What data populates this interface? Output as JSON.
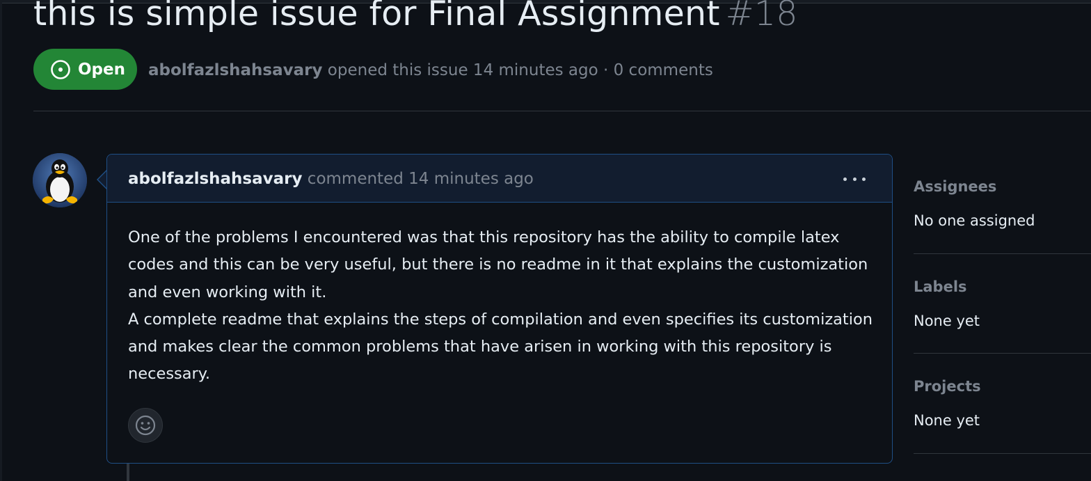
{
  "issue": {
    "title": "this is simple issue for Final Assignment",
    "number": "#18",
    "state": "Open",
    "author": "abolfazlshahsavary",
    "meta_text": " opened this issue 14 minutes ago · 0 comments"
  },
  "comment": {
    "author": "abolfazlshahsavary",
    "header_text": " commented 14 minutes ago",
    "body": [
      "One of the problems I encountered was that this repository has the ability to compile latex codes and this can be very useful, but there is no readme in it that explains the customization and even working with it.",
      "A complete readme that explains the steps of compilation and even specifies its customization and makes clear the common problems that have arisen in working with this repository is necessary."
    ]
  },
  "sidebar": {
    "assignees": {
      "heading": "Assignees",
      "value": "No one assigned"
    },
    "labels": {
      "heading": "Labels",
      "value": "None yet"
    },
    "projects": {
      "heading": "Projects",
      "value": "None yet"
    }
  },
  "icons": {
    "state": "issue-opened-icon",
    "menu": "kebab-horizontal-icon",
    "reaction": "smiley-icon",
    "avatar": "tux-penguin-avatar"
  },
  "colors": {
    "background": "#0d1117",
    "open_badge": "#238636",
    "comment_border": "#1f4f86",
    "comment_header": "#121d2f",
    "muted_text": "#7d8590",
    "primary_text": "#e6edf3"
  }
}
